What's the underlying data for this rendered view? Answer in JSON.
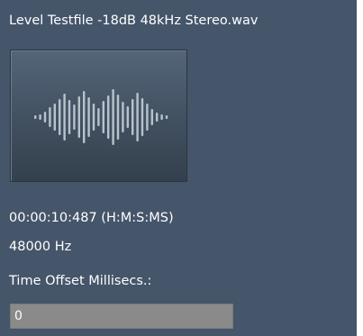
{
  "file": {
    "title": "Level Testfile -18dB 48kHz Stereo.wav",
    "thumbnail_icon": "audio-waveform-icon"
  },
  "info": {
    "duration": "00:00:10:487 (H:M:S:MS)",
    "sample_rate": "48000 Hz",
    "offset_label": "Time Offset Millisecs.:"
  },
  "offset_field": {
    "value": "0"
  },
  "colors": {
    "panel_background": "#45556a",
    "text": "#ffffff",
    "input_background": "#8a8a8a"
  }
}
